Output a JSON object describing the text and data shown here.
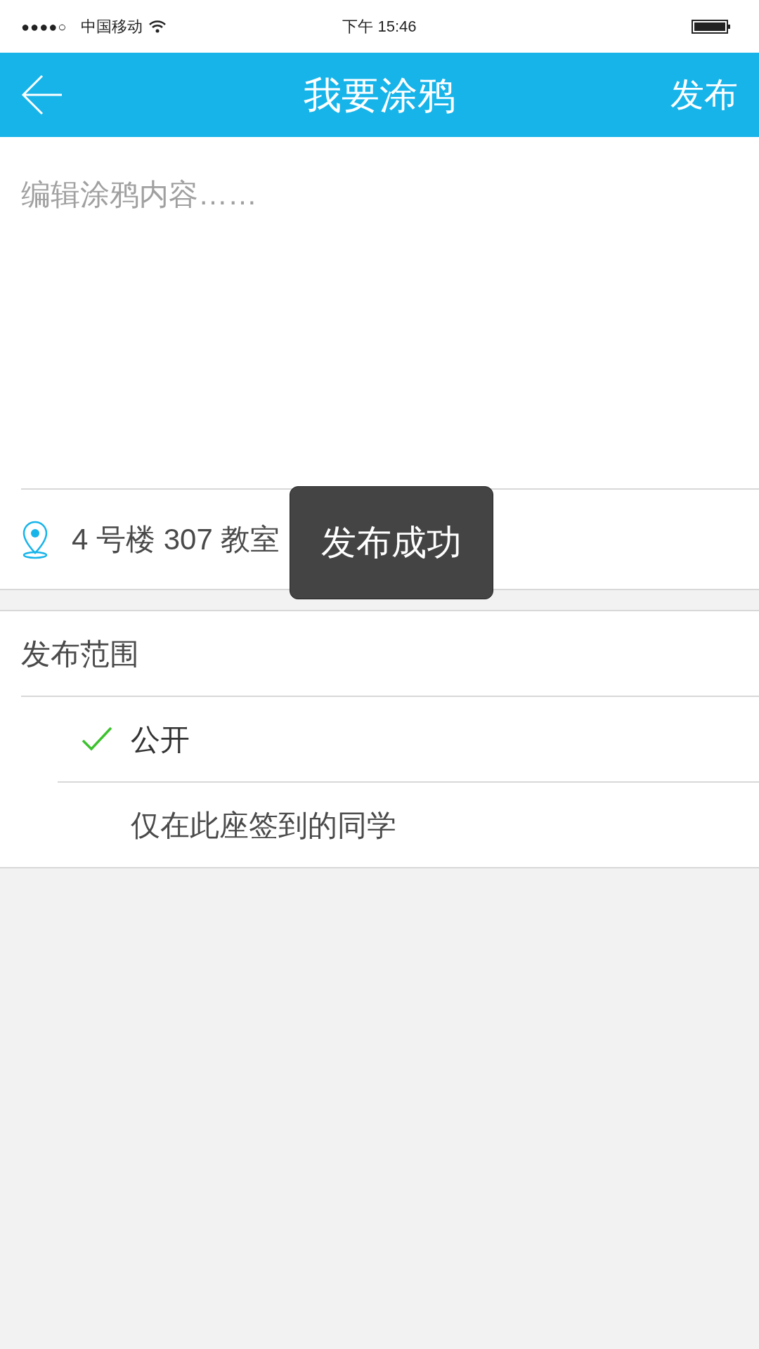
{
  "status_bar": {
    "signal_dots": "●●●●○",
    "carrier": "中国移动",
    "time": "下午 15:46"
  },
  "nav_bar": {
    "title": "我要涂鸦",
    "action": "发布"
  },
  "editor": {
    "placeholder": "编辑涂鸦内容……"
  },
  "location": {
    "text": "4 号楼 307 教室"
  },
  "scope": {
    "title": "发布范围",
    "options": [
      {
        "label": "公开",
        "selected": true
      },
      {
        "label": "仅在此座签到的同学",
        "selected": false
      }
    ]
  },
  "toast": {
    "text": "发布成功"
  }
}
